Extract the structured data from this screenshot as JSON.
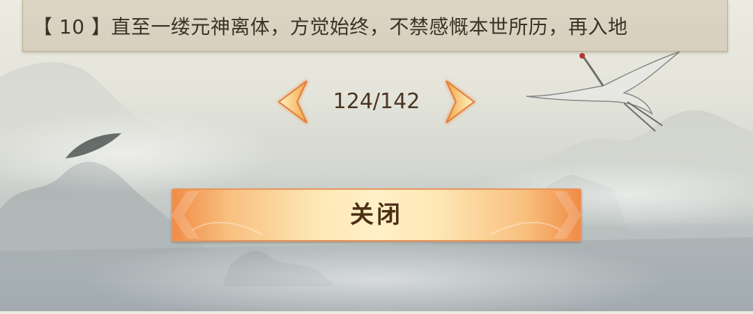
{
  "dialogue": {
    "text": "【 10 】直至一缕元神离体，方觉始终，不禁感慨本世所历，再入地"
  },
  "pager": {
    "page_label": "124/142",
    "prev_icon": "chevron-left-icon",
    "next_icon": "chevron-right-icon",
    "arrow_color": "#f5c36a"
  },
  "close_button": {
    "label": "关闭",
    "color": "#f08a44"
  },
  "background": {
    "scene": "ink-wash-mountains",
    "decorations": [
      "crane",
      "leaf"
    ]
  }
}
